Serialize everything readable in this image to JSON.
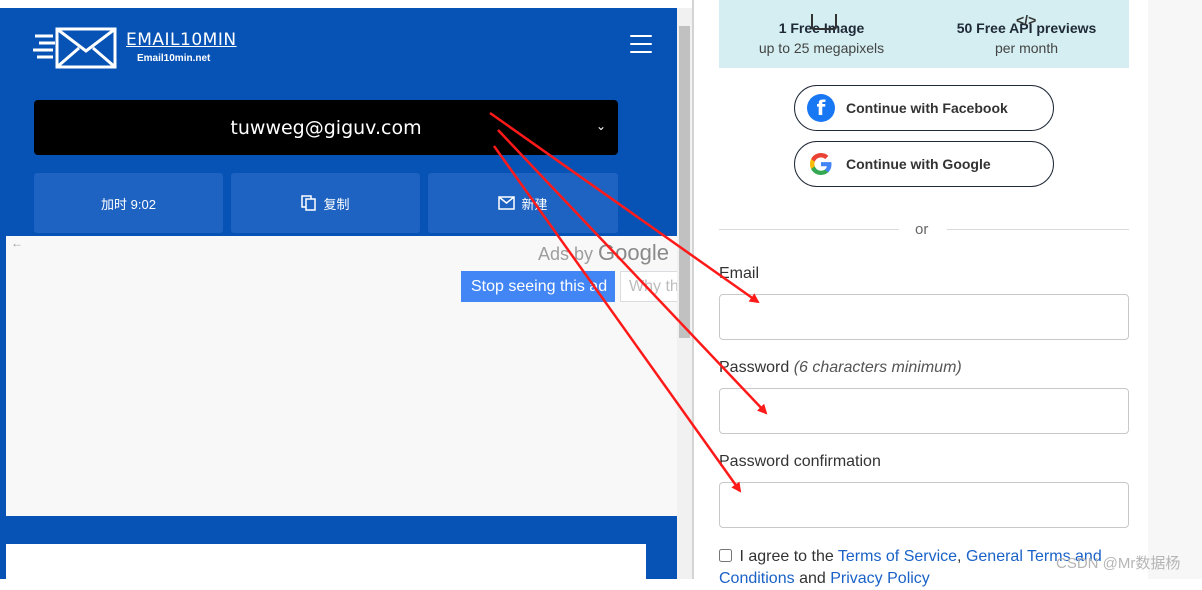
{
  "email_site": {
    "brand": "EMAIL10MIN",
    "brand_sub": "Email10min.net",
    "address": "tuwweg@giguv.com",
    "buttons": [
      {
        "label": "加时 9:02"
      },
      {
        "label": "复制",
        "icon": "copy-icon"
      },
      {
        "label": "新建",
        "icon": "mail-icon"
      }
    ],
    "ad": {
      "ads_by": "Ads by",
      "google": "Google",
      "stop_label": "Stop seeing this ad",
      "why_label": "Why th"
    }
  },
  "signup": {
    "promo": [
      {
        "title": "1 Free Image",
        "subtitle": "up to 25 megapixels"
      },
      {
        "title": "50 Free API previews",
        "subtitle": "per month"
      }
    ],
    "facebook_label": "Continue with Facebook",
    "google_label": "Continue with Google",
    "or_text": "or",
    "email_label": "Email",
    "password_label": "Password",
    "password_hint": "(6 characters minimum)",
    "confirm_label": "Password confirmation",
    "agree_prefix": "I agree to the",
    "terms_link": "Terms of Service",
    "comma": ",",
    "general_link": "General Terms and Conditions",
    "and_text": "and",
    "privacy_link": "Privacy Policy"
  },
  "watermark": "CSDN @Mr数据杨",
  "colors": {
    "panel_blue": "#0753b5",
    "button_blue": "#1e63c2",
    "promo_bg": "#d4eef1",
    "link_blue": "#1a62c7",
    "arrow_red": "#ff1a1a"
  }
}
